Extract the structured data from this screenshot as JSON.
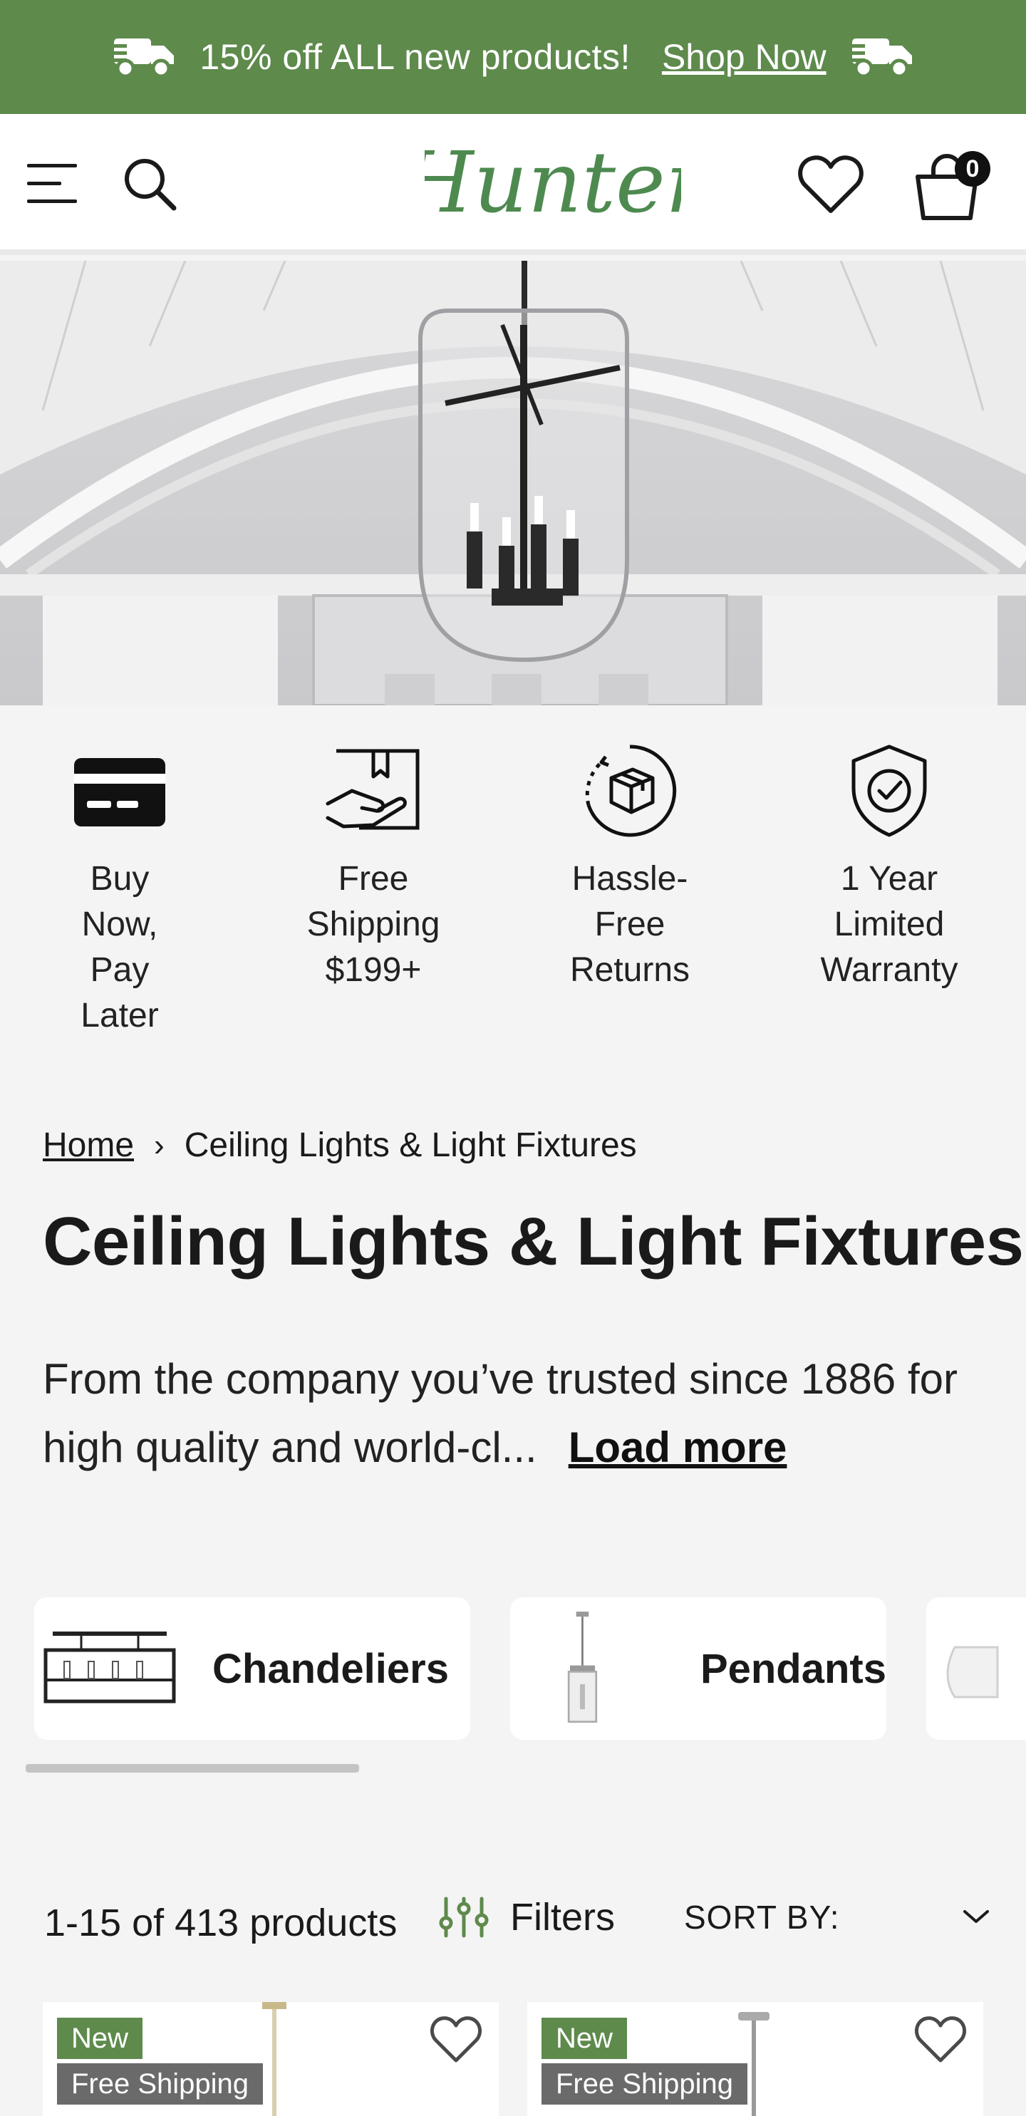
{
  "promo": {
    "text": "15% off ALL new products!",
    "link": "Shop Now"
  },
  "header": {
    "logo_text": "Hunter",
    "cart_count": "0"
  },
  "benefits": [
    {
      "label": "Buy Now, Pay Later",
      "icon": "credit-card-icon"
    },
    {
      "label": "Free Shipping $199+",
      "icon": "box-hand-icon"
    },
    {
      "label": "Hassle-Free Returns",
      "icon": "return-box-icon"
    },
    {
      "label": "1 Year Limited Warranty",
      "icon": "shield-check-icon"
    }
  ],
  "breadcrumb": {
    "home": "Home",
    "separator": "›",
    "current": "Ceiling Lights & Light Fixtures"
  },
  "page_title": "Ceiling Lights & Light Fixtures",
  "description": {
    "text": "From the company you’ve trusted since 1886 for high quality and world-cl...",
    "load_more": "Load more"
  },
  "categories": [
    {
      "name": "Chandeliers"
    },
    {
      "name": "Pendants"
    }
  ],
  "toolbar": {
    "count": "1-15 of 413 products",
    "filters": "Filters",
    "sort_label": "SORT BY:"
  },
  "products": [
    {
      "badge_new": "New",
      "badge_shipping": "Free Shipping"
    },
    {
      "badge_new": "New",
      "badge_shipping": "Free Shipping"
    }
  ],
  "colors": {
    "brand_green": "#5e8a4c",
    "badge_gray": "#6a6a6a"
  }
}
